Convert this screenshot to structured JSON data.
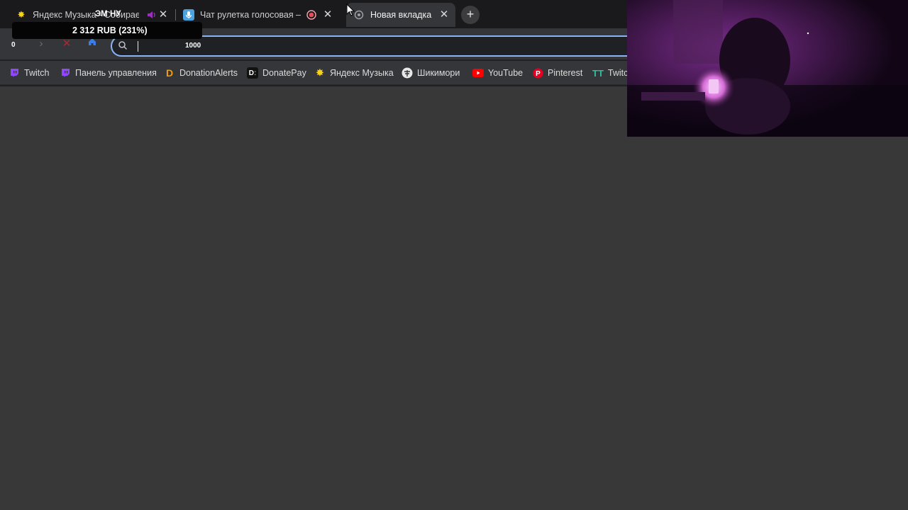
{
  "tabs": [
    {
      "title": "Яндекс Музыка - Собираем",
      "favicon": "yandex-music-icon",
      "active": false
    },
    {
      "title": "Чат рулетка голосовая — ",
      "favicon": "microphone-icon",
      "active": false
    },
    {
      "title": "Новая вкладка",
      "favicon": "new-tab-icon",
      "active": true
    }
  ],
  "new_tab_label": "+",
  "overlay": {
    "label": "ЭМ НУ",
    "amount": "2 312 RUB (231%)",
    "goal_start": "0",
    "goal_end": "1000"
  },
  "bookmarks": [
    {
      "label": "Twitch",
      "icon": "twitch-icon"
    },
    {
      "label": "Панель управления",
      "icon": "twitch-dashboard-icon"
    },
    {
      "label": "DonationAlerts",
      "icon": "donationalerts-icon"
    },
    {
      "label": "DonatePay",
      "icon": "donatepay-icon"
    },
    {
      "label": "Яндекс Музыка",
      "icon": "yandex-music-icon"
    },
    {
      "label": "Шикимори",
      "icon": "shikimori-icon"
    },
    {
      "label": "YouTube",
      "icon": "youtube-icon"
    },
    {
      "label": "Pinterest",
      "icon": "pinterest-icon"
    },
    {
      "label": "Twitch",
      "icon": "twitch-tracker-icon"
    }
  ],
  "colors": {
    "accent": "#8ab4f8",
    "twitch": "#9146ff",
    "youtube": "#ff0000",
    "pinterest": "#e60023",
    "donationalerts": "#f59c07",
    "page_background": "#383838"
  }
}
